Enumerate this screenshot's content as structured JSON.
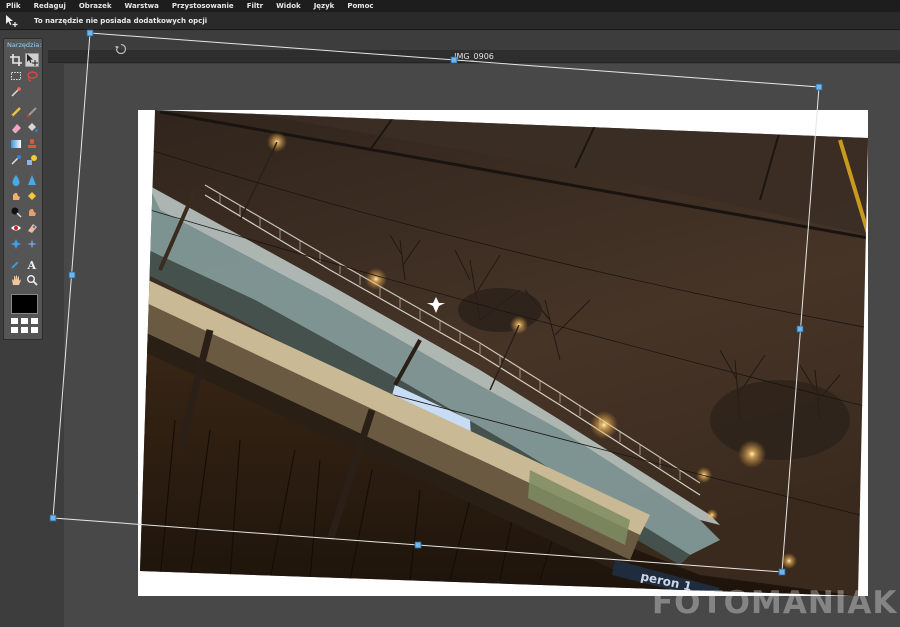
{
  "menu": {
    "items": [
      "Plik",
      "Redaguj",
      "Obrazek",
      "Warstwa",
      "Przystosowanie",
      "Filtr",
      "Widok",
      "Język",
      "Pomoc"
    ]
  },
  "options": {
    "message": "To narzędzie nie posiada dodatkowych opcji",
    "tool_icon": "move-tool-icon"
  },
  "toolbox": {
    "title": "Narzędzia:",
    "tools": [
      "crop-icon",
      "move-icon",
      "marquee-icon",
      "lasso-icon",
      "wand-icon",
      "pencil-icon",
      "brush-icon",
      "eraser-icon",
      "bucket-icon",
      "gradient-icon",
      "stamp-icon",
      "color-replace-icon",
      "drawing-icon",
      "blur-icon",
      "sharpen-icon",
      "smudge-icon",
      "sponge-icon",
      "dodge-icon",
      "burn-icon",
      "red-eye-icon",
      "spot-heal-icon",
      "bloat-icon",
      "pinch-icon",
      "picker-icon",
      "type-icon",
      "hand-icon",
      "zoom-icon"
    ],
    "foreground_color": "#000000"
  },
  "document": {
    "title": "IMG_0906"
  },
  "photo": {
    "sign_text": "peron 1"
  },
  "watermark": {
    "text": "FOTOMANIAK"
  },
  "colors": {
    "menubar": "#1d1d1d",
    "accent": "#8fd2ff",
    "handle": "#5aa8e6"
  }
}
